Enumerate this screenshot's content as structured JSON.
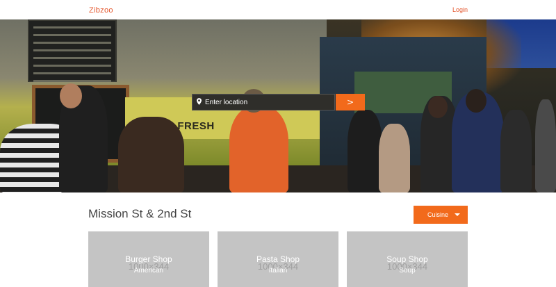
{
  "header": {
    "brand": "Zibzoo",
    "login_label": "Login"
  },
  "hero": {
    "truck_sign": "ARM FRESH",
    "search": {
      "placeholder": "Enter location",
      "submit_label": ">"
    }
  },
  "section": {
    "location_title": "Mission St & 2nd St",
    "filter_label": "Cuisine"
  },
  "cards": [
    {
      "name": "Burger Shop",
      "category": "American",
      "placeholder": "1000×344"
    },
    {
      "name": "Pasta Shop",
      "category": "Italian",
      "placeholder": "1000×344"
    },
    {
      "name": "Soup Shop",
      "category": "Soup",
      "placeholder": "1000×344"
    }
  ],
  "colors": {
    "accent": "#f26a1b",
    "brand": "#e4572e",
    "card_bg": "#c4c4c4"
  },
  "icons": [
    "map-pin-icon",
    "caret-down-icon"
  ]
}
